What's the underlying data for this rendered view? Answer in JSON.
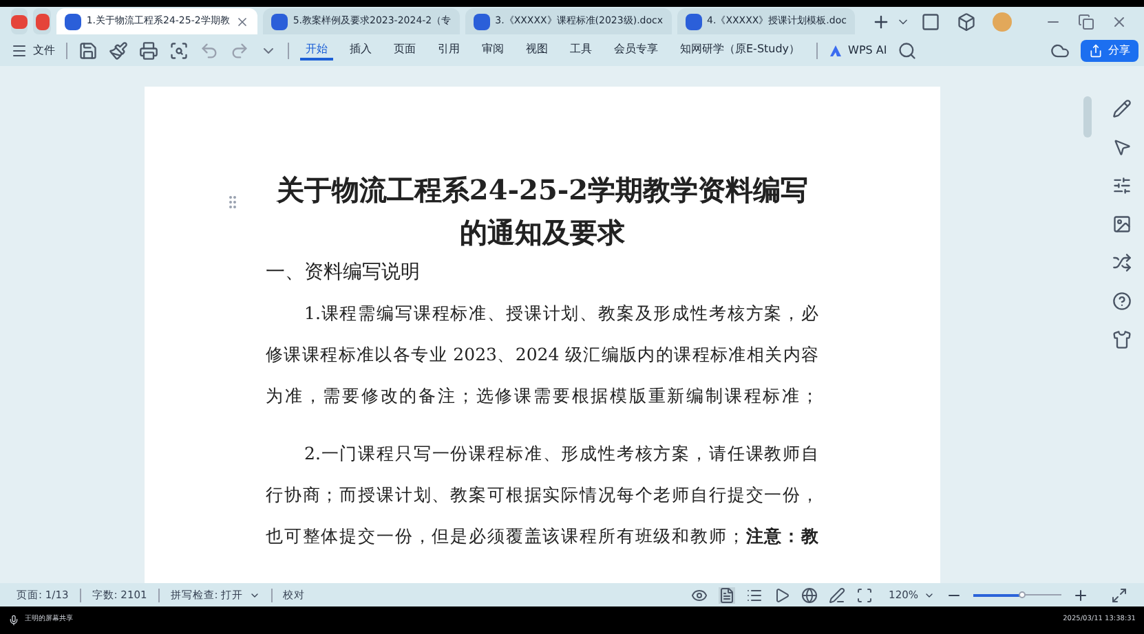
{
  "tabs": [
    {
      "label": "1.关于物流工程系24-25-2学期教",
      "selected": true
    },
    {
      "label": "5.教案样例及要求2023-2024-2（专",
      "selected": false
    },
    {
      "label": "3.《XXXXX》课程标准(2023级).docx",
      "selected": false
    },
    {
      "label": "4.《XXXXX》授课计划模板.doc",
      "selected": false
    }
  ],
  "toolbar": {
    "file_menu": "文件",
    "menus": [
      {
        "label": "开始",
        "selected": true
      },
      {
        "label": "插入",
        "selected": false
      },
      {
        "label": "页面",
        "selected": false
      },
      {
        "label": "引用",
        "selected": false
      },
      {
        "label": "审阅",
        "selected": false
      },
      {
        "label": "视图",
        "selected": false
      },
      {
        "label": "工具",
        "selected": false
      },
      {
        "label": "会员专享",
        "selected": false
      },
      {
        "label": "知网研学（原E-Study）",
        "selected": false
      }
    ],
    "ai": "WPS AI",
    "share": "分享"
  },
  "document": {
    "title": [
      "关于物流工程系24-25-2学期教学资料编写",
      "的通知及要求"
    ],
    "heading": "一、资料编写说明",
    "paragraphs": [
      [
        "1.课程需编写课程标准、授课计划、教案及形成性考核方案，必",
        "修课课程标准以各专业 2023、2024 级汇编版内的课程标准相关内容",
        "为准，需要修改的备注；选修课需要根据模版重新编制课程标准；"
      ],
      [
        "2.一门课程只写一份课程标准、形成性考核方案，请任课教师自",
        "行协商；而授课计划、教案可根据实际情况每个老师自行提交一份，",
        "也可整体提交一份，但是必须覆盖该课程所有班级和教师；**注意：教**"
      ]
    ]
  },
  "status_bar": {
    "page": "页面: 1/13",
    "words": "字数: 2101",
    "spell": "拼写检查: 打开",
    "proofread": "校对",
    "zoom": "120%",
    "zoom_slider": {
      "level": 0.55
    }
  },
  "screen_share": {
    "label": "王明的屏幕共享",
    "timestamp": "2025/03/11 13:38:31"
  }
}
